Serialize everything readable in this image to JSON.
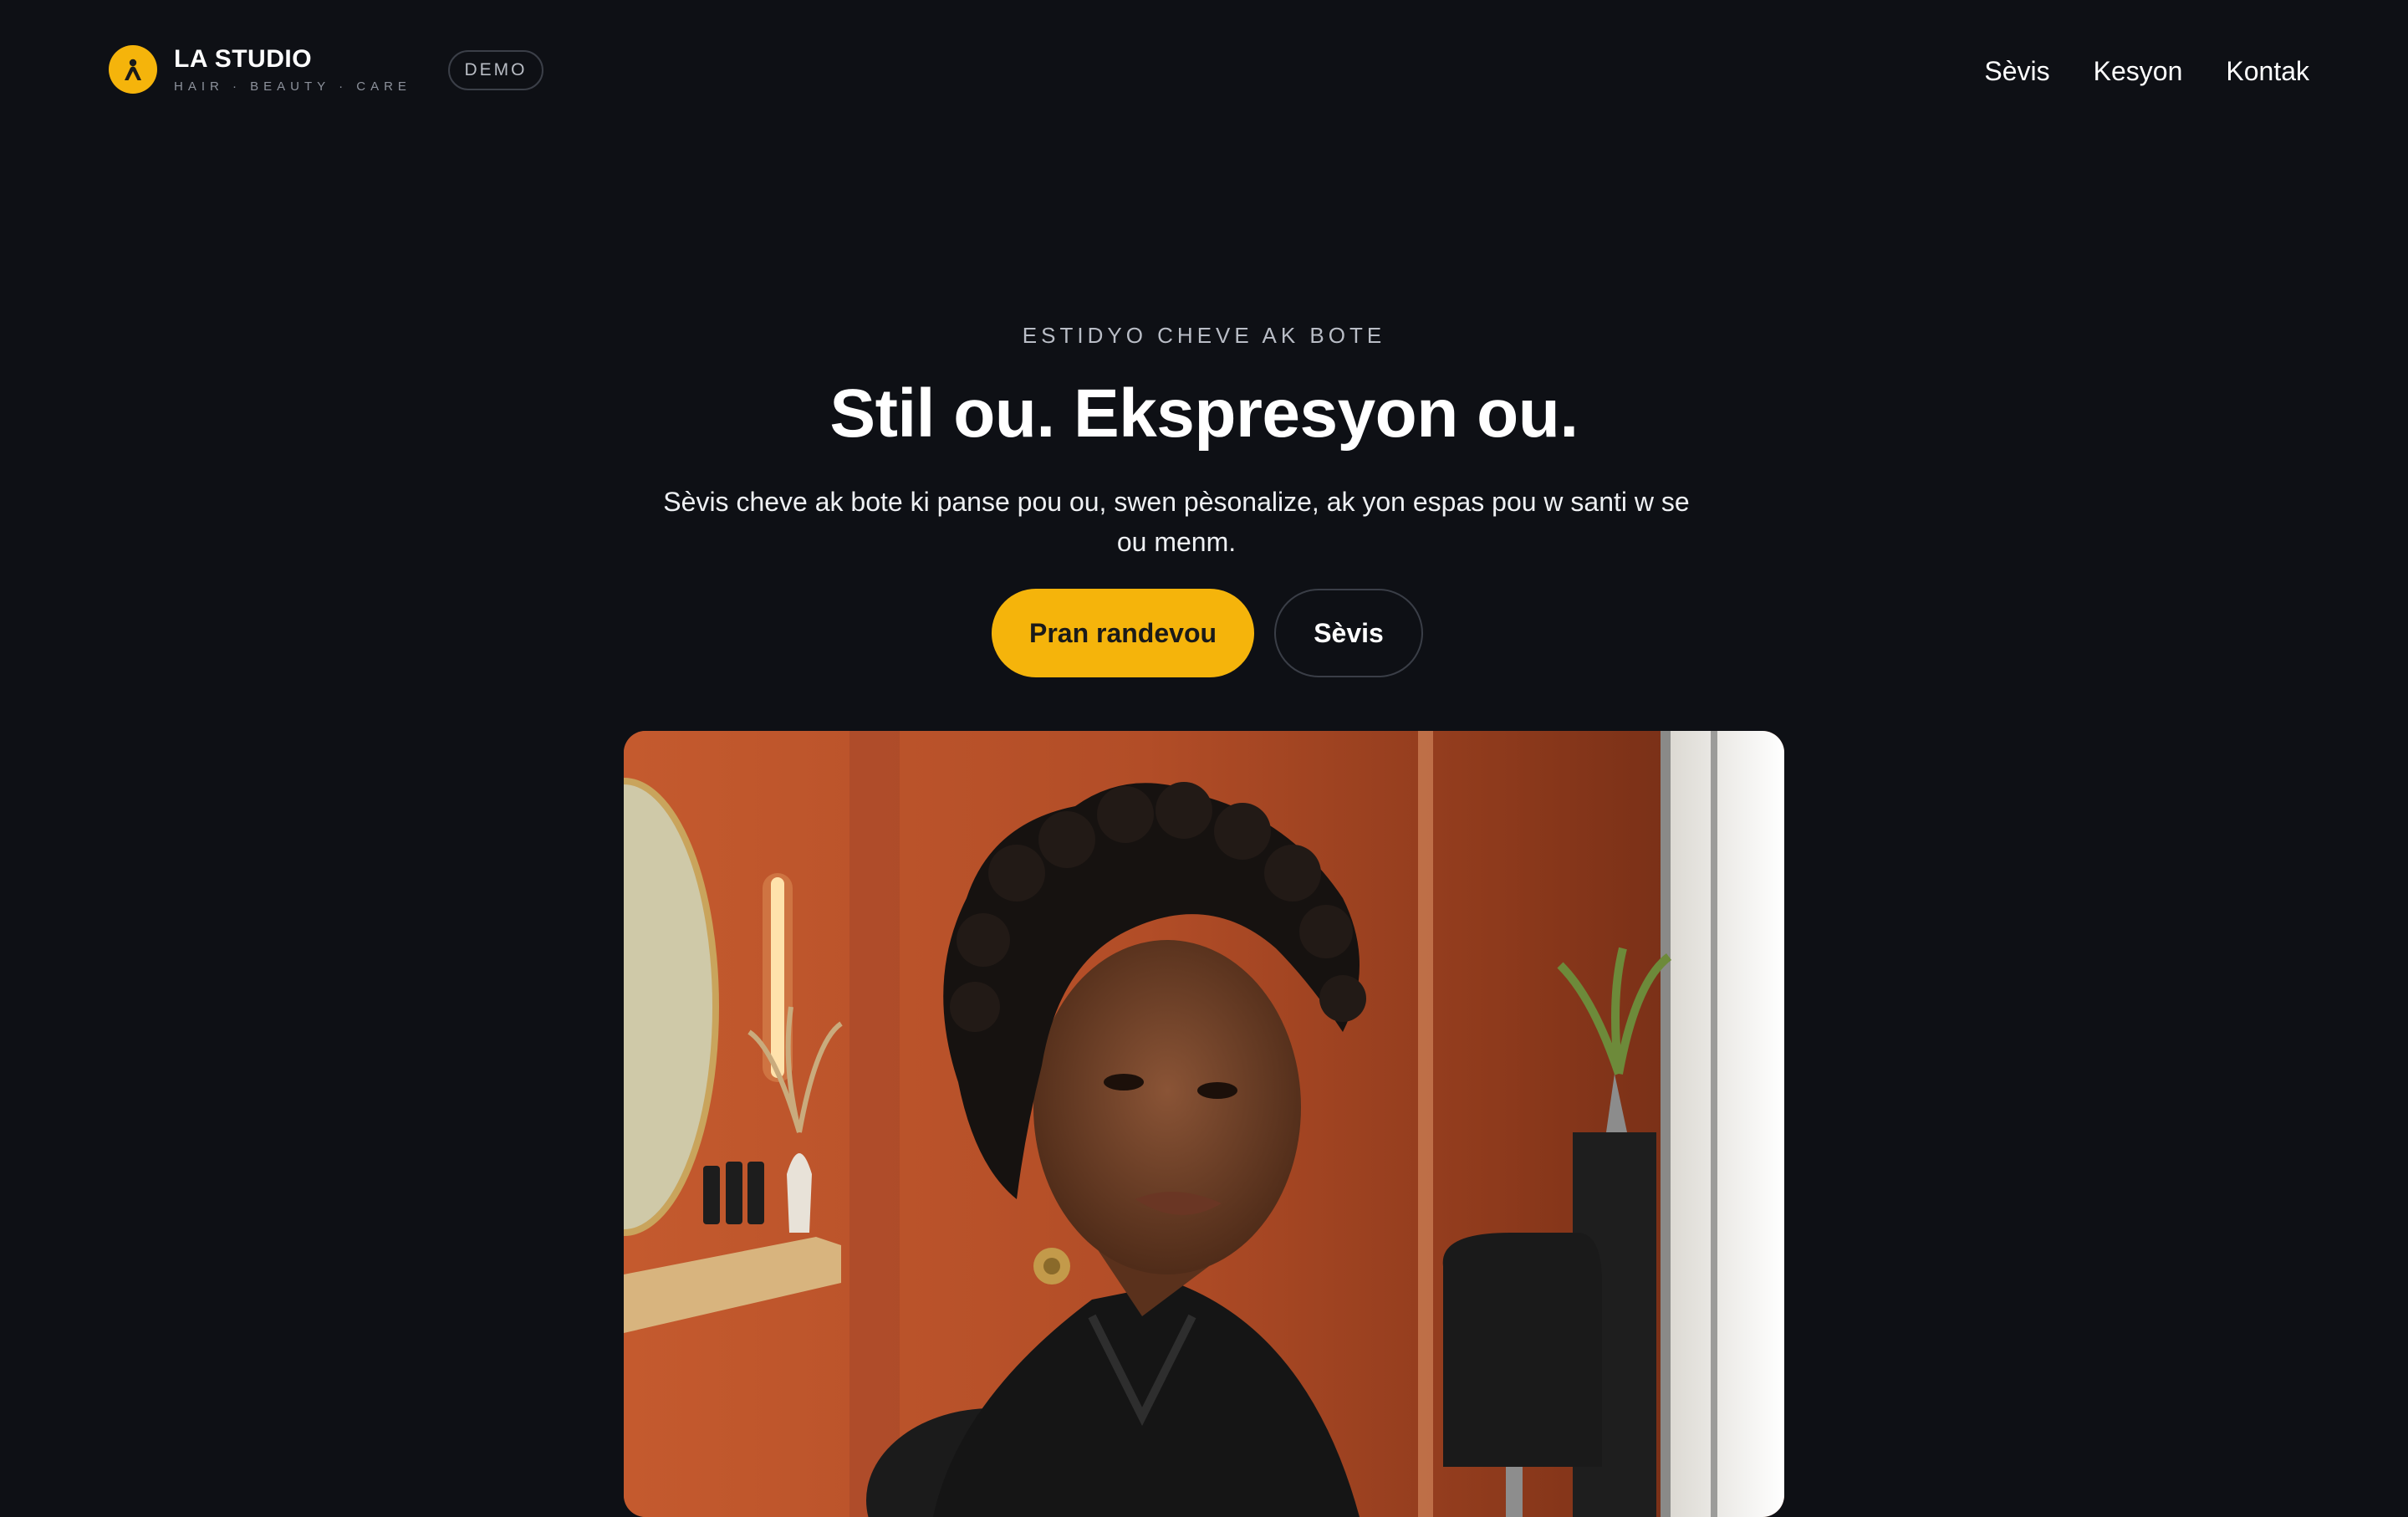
{
  "header": {
    "brand_name": "LA STUDIO",
    "brand_tagline": "HAIR · BEAUTY · CARE",
    "logo_icon": "person-icon",
    "demo_badge": "DEMO",
    "nav": [
      {
        "label": "Sèvis"
      },
      {
        "label": "Kesyon"
      },
      {
        "label": "Kontak"
      }
    ]
  },
  "hero": {
    "eyebrow": "ESTIDYO CHEVE AK BOTE",
    "title": "Stil ou. Ekspresyon ou.",
    "subtitle": "Sèvis cheve ak bote ki panse pou ou, swen pèsonalize, ak yon espas pou w santi w se ou menm.",
    "primary_button": "Pran randevou",
    "secondary_button": "Sèvis"
  },
  "colors": {
    "background": "#0e1015",
    "accent": "#f5b40b",
    "text": "#ffffff",
    "muted": "#8d929c"
  }
}
